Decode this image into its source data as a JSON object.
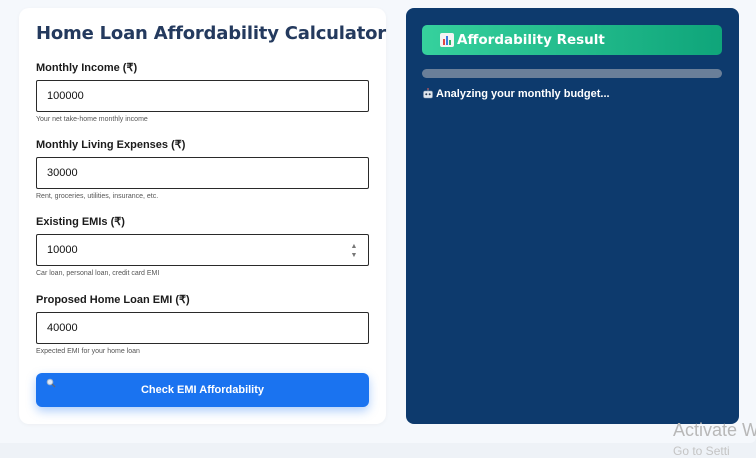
{
  "form": {
    "title": "Home Loan Affordability Calculator",
    "fields": [
      {
        "label": "Monthly Income (₹)",
        "value": "100000",
        "hint": "Your net take-home monthly income"
      },
      {
        "label": "Monthly Living Expenses (₹)",
        "value": "30000",
        "hint": "Rent, groceries, utilities, insurance, etc."
      },
      {
        "label": "Existing EMIs (₹)",
        "value": "10000",
        "hint": "Car loan, personal loan, credit card EMI"
      },
      {
        "label": "Proposed Home Loan EMI (₹)",
        "value": "40000",
        "hint": "Expected EMI for your home loan"
      }
    ],
    "button_label": "Check EMI Affordability",
    "button_icon": "magnifier-icon"
  },
  "result": {
    "title": "Affordability Result",
    "title_icon": "bar-chart-icon",
    "progress": 0,
    "status_icon": "robot-icon",
    "status_text": "Analyzing your monthly budget..."
  },
  "watermark": {
    "line1": "Activate W",
    "line2": "Go to Setti"
  },
  "colors": {
    "title": "#243a5e",
    "button": "#1a73f0",
    "result_panel": "#0d3a6d",
    "result_header_start": "#36d19d",
    "result_header_end": "#0fa57a"
  }
}
